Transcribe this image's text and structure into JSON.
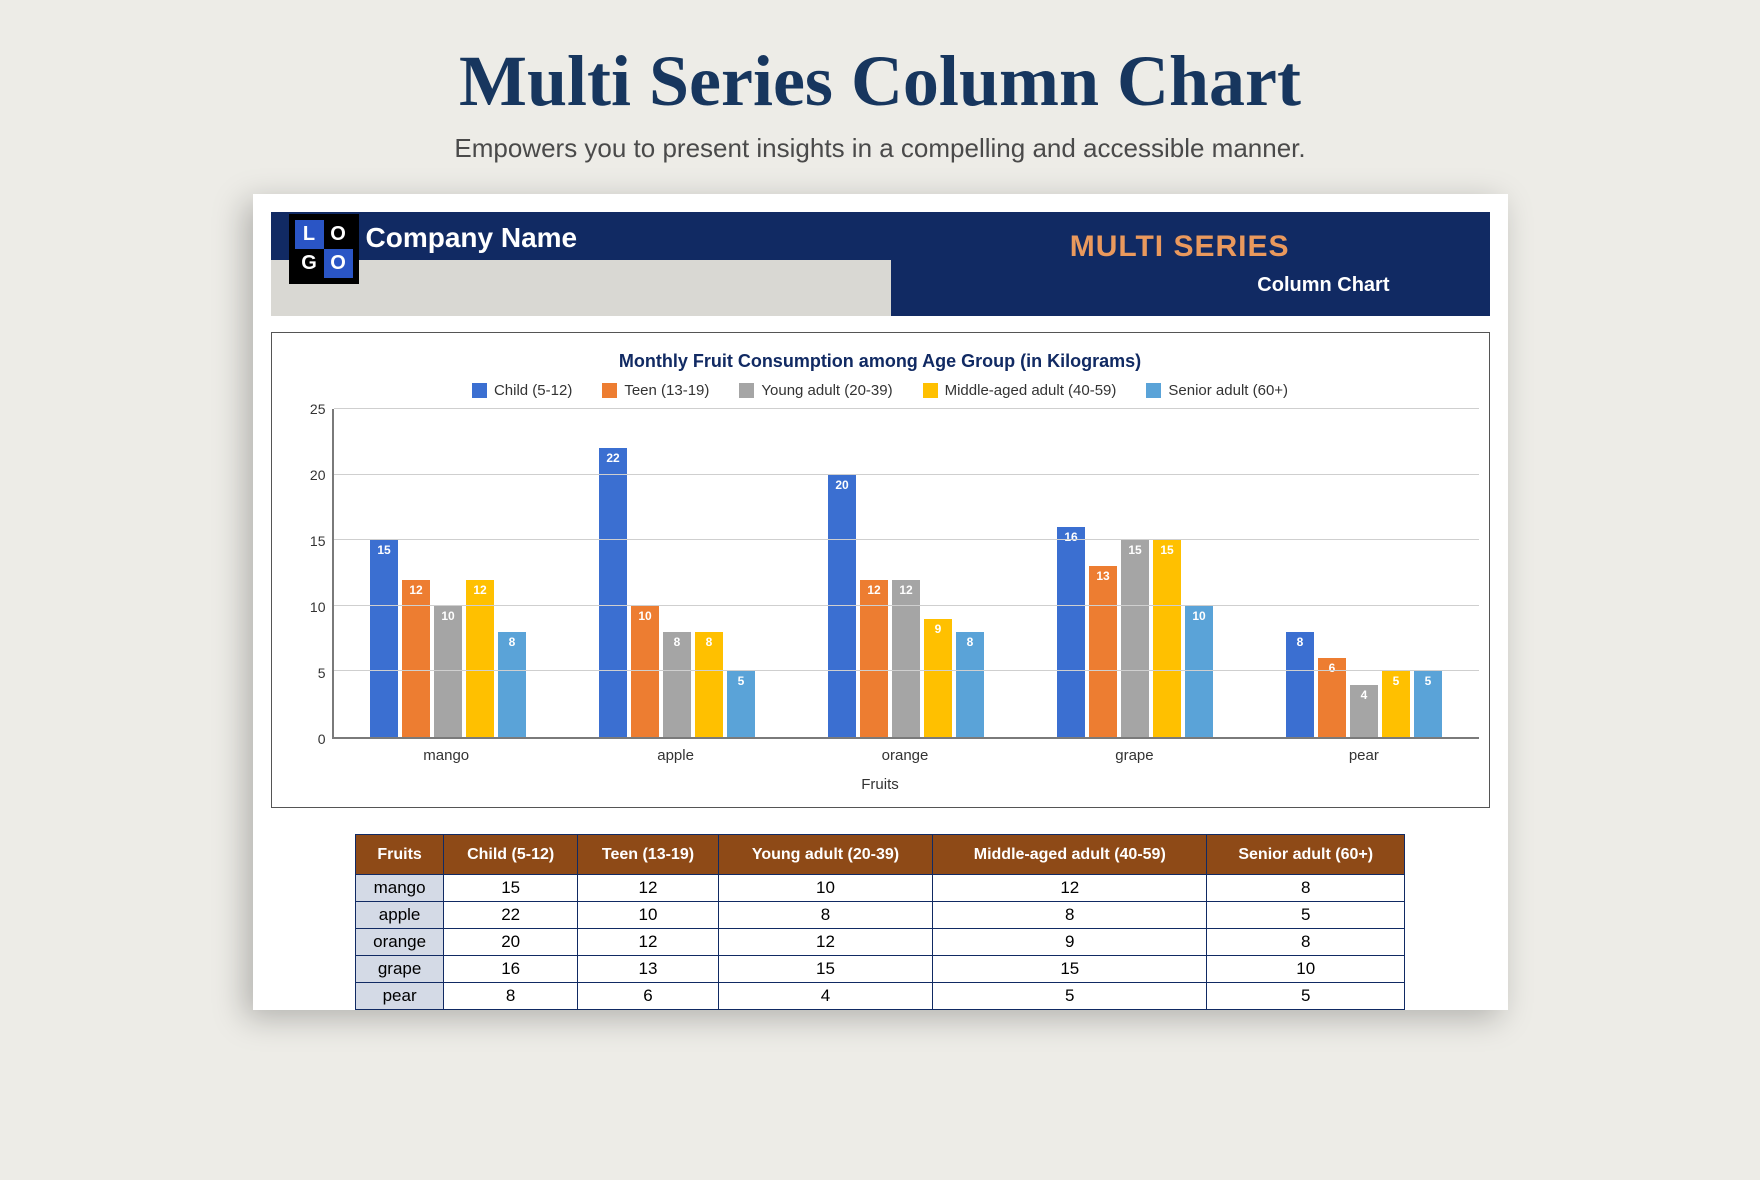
{
  "page": {
    "title": "Multi Series Column Chart",
    "subtitle": "Empowers you to present insights in a compelling and accessible manner."
  },
  "doc_header": {
    "logo_letters": [
      "L",
      "O",
      "G",
      "O"
    ],
    "company": "Company Name",
    "multi_series": "MULTI SERIES",
    "sub": "Column Chart"
  },
  "chart_data": {
    "type": "bar",
    "title": "Monthly Fruit Consumption among Age Group (in Kilograms)",
    "xlabel": "Fruits",
    "ylabel": "",
    "ylim": [
      0,
      25
    ],
    "yticks": [
      0,
      5,
      10,
      15,
      20,
      25
    ],
    "categories": [
      "mango",
      "apple",
      "orange",
      "grape",
      "pear"
    ],
    "series": [
      {
        "name": "Child (5-12)",
        "color": "#3b6fd1",
        "values": [
          15,
          22,
          20,
          16,
          8
        ]
      },
      {
        "name": "Teen (13-19)",
        "color": "#ed7d31",
        "values": [
          12,
          10,
          12,
          13,
          6
        ]
      },
      {
        "name": "Young adult (20-39)",
        "color": "#a5a5a5",
        "values": [
          10,
          8,
          12,
          15,
          4
        ]
      },
      {
        "name": "Middle-aged adult (40-59)",
        "color": "#ffc000",
        "values": [
          12,
          8,
          9,
          15,
          5
        ]
      },
      {
        "name": "Senior adult (60+)",
        "color": "#5aa3d8",
        "values": [
          8,
          5,
          8,
          10,
          5
        ]
      }
    ]
  },
  "table": {
    "header_first": "Fruits",
    "headers": [
      "Child (5-12)",
      "Teen (13-19)",
      "Young adult (20-39)",
      "Middle-aged adult (40-59)",
      "Senior adult (60+)"
    ]
  }
}
